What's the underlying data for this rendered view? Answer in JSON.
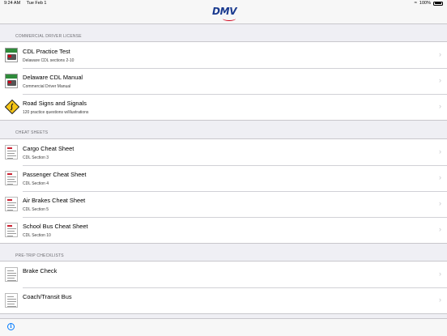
{
  "status": {
    "time": "9:24 AM",
    "date": "Tue Feb 1",
    "battery": "100%"
  },
  "header": {
    "logo_text": "DMV"
  },
  "sections": [
    {
      "title": "COMMERCIAL DRIVER LICENSE",
      "items": [
        {
          "title": "CDL Practice Test",
          "subtitle": "Delaware CDL sections 2-10",
          "icon": "cdl-manual-icon"
        },
        {
          "title": "Delaware CDL Manual",
          "subtitle": "Commercial Driver Manual",
          "icon": "cdl-manual-icon"
        },
        {
          "title": "Road Signs and Signals",
          "subtitle": "120 practice questions w/illustrations",
          "icon": "winding-road-sign-icon"
        }
      ]
    },
    {
      "title": "CHEAT SHEETS",
      "items": [
        {
          "title": "Cargo Cheat Sheet",
          "subtitle": "CDL Section 3",
          "icon": "cheat-sheet-icon"
        },
        {
          "title": "Passenger Cheat Sheet",
          "subtitle": "CDL Section 4",
          "icon": "cheat-sheet-icon"
        },
        {
          "title": "Air Brakes Cheat Sheet",
          "subtitle": "CDL Section 5",
          "icon": "cheat-sheet-icon"
        },
        {
          "title": "School Bus Cheat Sheet",
          "subtitle": "CDL Section 10",
          "icon": "cheat-sheet-icon"
        }
      ]
    },
    {
      "title": "PRE-TRIP CHECKLISTS",
      "items": [
        {
          "title": "Brake Check",
          "icon": "checklist-icon"
        },
        {
          "title": "Coach/Transit Bus",
          "icon": "checklist-icon"
        }
      ]
    }
  ],
  "toolbar": {
    "info_icon": "info-icon",
    "info_glyph": "i"
  },
  "colors": {
    "accent": "#007aff",
    "background": "#efeff4",
    "logo_blue": "#1a3a8f",
    "logo_red": "#d0021b"
  }
}
